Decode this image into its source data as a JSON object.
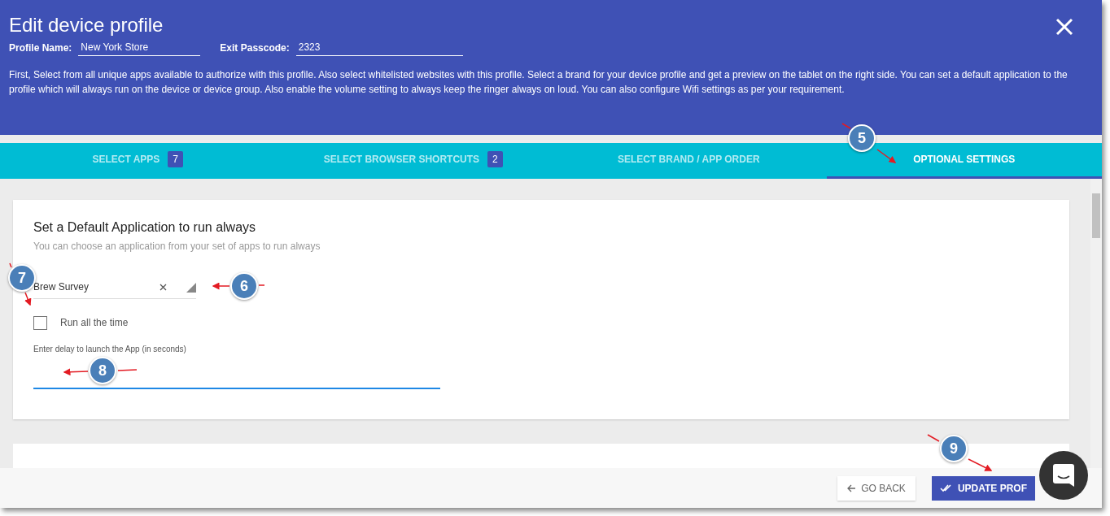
{
  "dialog": {
    "title": "Edit device profile",
    "fields": [
      {
        "label": "Profile Name:",
        "value": "New York Store"
      },
      {
        "label": "Exit Passcode:",
        "value": "2323"
      }
    ],
    "description": "First, Select from all unique apps available to authorize with this profile. Also select whitelisted websites with this profile. Select a brand for your device profile and get a preview on the tablet on the right side. You can set a default application to the profile which will always run on the device or device group. Also enable the volume setting to always keep the ringer always on loud. You can also configure Wifi settings as per your requirement."
  },
  "tabs": [
    {
      "label": "SELECT APPS",
      "count": "7",
      "selected": false
    },
    {
      "label": "SELECT BROWSER SHORTCUTS",
      "count": "2",
      "selected": false
    },
    {
      "label": "SELECT BRAND / APP ORDER",
      "selected": false
    },
    {
      "label": "OPTIONAL SETTINGS",
      "selected": true
    }
  ],
  "default_app": {
    "title": "Set a Default Application to run always",
    "subtitle": "You can choose an application from your set of apps to run always",
    "app_select": {
      "value": "Brew Survey"
    },
    "run_all_the_time": {
      "label": "Run all the time",
      "checked": false
    },
    "delay_field": {
      "label": "Enter delay to launch the App (in seconds)"
    }
  },
  "footer": {
    "buttons": [
      {
        "kind": "back",
        "label": "GO BACK"
      },
      {
        "kind": "primary",
        "label": "UPDATE PROF"
      }
    ]
  },
  "callouts": [
    {
      "label": "5"
    },
    {
      "label": "6"
    },
    {
      "label": "7"
    },
    {
      "label": "8"
    },
    {
      "label": "9"
    }
  ]
}
